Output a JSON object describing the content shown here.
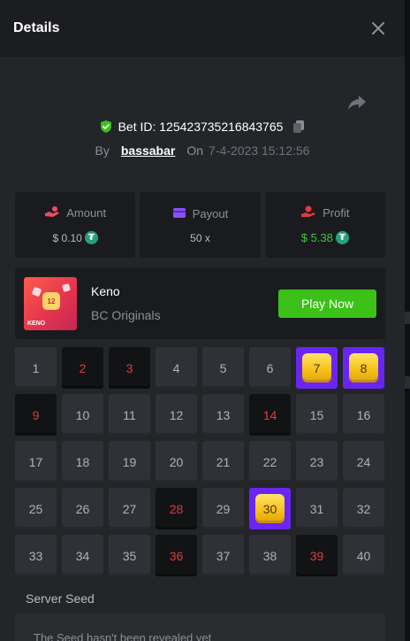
{
  "header": {
    "title": "Details"
  },
  "bet": {
    "id_label": "Bet ID: 125423735216843765",
    "by_label": "By",
    "username": "bassabar",
    "on_label": "On",
    "date": "7-4-2023 15:12:56"
  },
  "stats": [
    {
      "label": "Amount",
      "value": "$ 0.10",
      "icon": "coins-hand-icon",
      "currency": "tether-icon"
    },
    {
      "label": "Payout",
      "value": "50 x",
      "icon": "wallet-icon"
    },
    {
      "label": "Profit",
      "value": "$ 5.38",
      "icon": "money-hand-icon",
      "currency": "tether-icon",
      "value_color": "#3ec638"
    }
  ],
  "game": {
    "thumb_number": "12",
    "thumb_label": "KENO",
    "name": "Keno",
    "provider": "BC Originals",
    "play_label": "Play Now"
  },
  "board": {
    "numbers": [
      "1",
      "2",
      "3",
      "4",
      "5",
      "6",
      "7",
      "8",
      "9",
      "10",
      "11",
      "12",
      "13",
      "14",
      "15",
      "16",
      "17",
      "18",
      "19",
      "20",
      "21",
      "22",
      "23",
      "24",
      "25",
      "26",
      "27",
      "28",
      "29",
      "30",
      "31",
      "32",
      "33",
      "34",
      "35",
      "36",
      "37",
      "38",
      "39",
      "40"
    ],
    "drawn_misses": [
      2,
      3,
      9,
      14,
      28,
      36,
      39
    ],
    "hits": [
      7,
      8,
      30
    ]
  },
  "seed": {
    "label": "Server Seed",
    "text": "The Seed hasn't been revealed yet"
  },
  "colors": {
    "accent_green": "#3bc117",
    "hit_purple": "#6a25f4",
    "miss_red": "#e23b3b",
    "gem_yellow": "#f7c21a"
  }
}
